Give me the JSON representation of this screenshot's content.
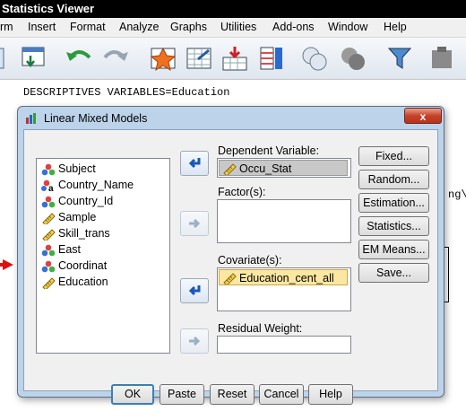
{
  "background_window": {
    "title": "Statistics Viewer",
    "menu": [
      "rm",
      "Insert",
      "Format",
      "Analyze",
      "Graphs",
      "Utilities",
      "Add-ons",
      "Window",
      "Help"
    ],
    "syntax_line": "DESCRIPTIVES VARIABLES=Education",
    "right_fragment": "ng\\"
  },
  "dialog": {
    "title": "Linear Mixed Models",
    "close_label": "x",
    "variables": [
      {
        "name": "Subject",
        "icon": "nominal-icon"
      },
      {
        "name": "Country_Name",
        "icon": "nominal-string-icon"
      },
      {
        "name": "Country_Id",
        "icon": "nominal-icon"
      },
      {
        "name": "Sample",
        "icon": "scale-ruler-icon"
      },
      {
        "name": "Skill_trans",
        "icon": "scale-ruler-icon"
      },
      {
        "name": "East",
        "icon": "nominal-icon"
      },
      {
        "name": "Coordinat",
        "icon": "nominal-icon"
      },
      {
        "name": "Education",
        "icon": "scale-ruler-icon"
      }
    ],
    "dependent_label": "Dependent Variable:",
    "dependent_value": "Occu_Stat",
    "factors_label": "Factor(s):",
    "covariates_label": "Covariate(s):",
    "covariate_value": "Education_cent_all",
    "residual_label": "Residual Weight:",
    "side_buttons": [
      "Fixed...",
      "Random...",
      "Estimation...",
      "Statistics...",
      "EM Means...",
      "Save..."
    ],
    "bottom_buttons": {
      "ok": "OK",
      "paste": "Paste",
      "reset": "Reset",
      "cancel": "Cancel",
      "help": "Help"
    }
  }
}
